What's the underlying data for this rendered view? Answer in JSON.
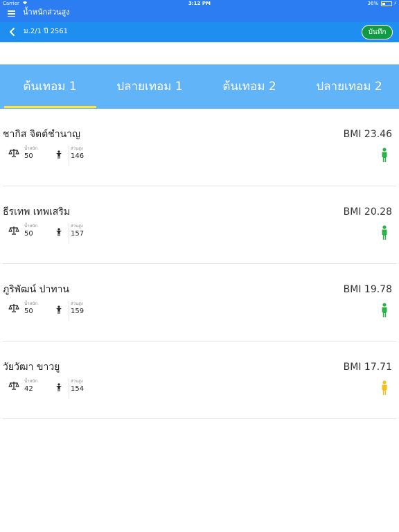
{
  "status_bar": {
    "carrier": "Carrier",
    "time": "3:12 PM",
    "battery": "36%",
    "battery_level": 0.36
  },
  "app_bar": {
    "title": "น้ำหนักส่วนสูง"
  },
  "sub_bar": {
    "class_label": "ม.2/1 ปี 2561",
    "save_label": "บันทึก"
  },
  "tabs": [
    {
      "label": "ต้นเทอม 1",
      "selected": true
    },
    {
      "label": "ปลายเทอม 1",
      "selected": false
    },
    {
      "label": "ต้นเทอม 2",
      "selected": false
    },
    {
      "label": "ปลายเทอม 2",
      "selected": false
    }
  ],
  "colors": {
    "bar_blue": "#2c7cf2",
    "sub_blue": "#1f8ef1",
    "tab_blue": "#61b4f7",
    "indicator": "#ffe633",
    "save_green": "#0f9a43",
    "normal": "#2bb34a",
    "under": "#f0c21b"
  },
  "labels": {
    "weight": "น้ำหนัก",
    "height": "ส่วนสูง"
  },
  "students": [
    {
      "name": "ชากิส จิตต์ชำนาญ",
      "bmi": "BMI 23.46",
      "weight": "50",
      "height": "146",
      "status_color": "#2bb34a",
      "status_icon": "person-green-icon"
    },
    {
      "name": "ธีรเทพ เทพเสริม",
      "bmi": "BMI 20.28",
      "weight": "50",
      "height": "157",
      "status_color": "#2bb34a",
      "status_icon": "person-green-icon"
    },
    {
      "name": "ภูริพัฒน์ ปาทาน",
      "bmi": "BMI 19.78",
      "weight": "50",
      "height": "159",
      "status_color": "#2bb34a",
      "status_icon": "person-green-icon"
    },
    {
      "name": "วัยวัฒา ขาวยู",
      "bmi": "BMI 17.71",
      "weight": "42",
      "height": "154",
      "status_color": "#f0c21b",
      "status_icon": "person-yellow-icon"
    }
  ]
}
